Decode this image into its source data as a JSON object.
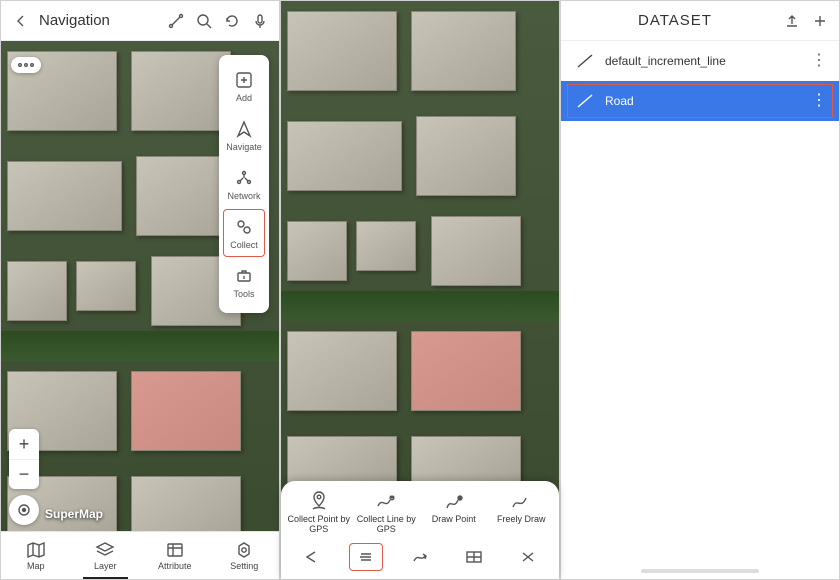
{
  "panel1": {
    "title": "Navigation",
    "toolcol": [
      {
        "label": "Add",
        "icon": "plus-square-icon"
      },
      {
        "label": "Navigate",
        "icon": "navigate-icon"
      },
      {
        "label": "Network",
        "icon": "network-icon"
      },
      {
        "label": "Collect",
        "icon": "collect-icon",
        "selected": true
      },
      {
        "label": "Tools",
        "icon": "tools-icon"
      }
    ],
    "attribution": "SuperMap",
    "bottom_nav": [
      {
        "label": "Map",
        "icon": "map-icon"
      },
      {
        "label": "Layer",
        "icon": "layer-icon",
        "active": true
      },
      {
        "label": "Attribute",
        "icon": "attribute-icon"
      },
      {
        "label": "Setting",
        "icon": "setting-icon"
      }
    ]
  },
  "panel2": {
    "actions": [
      {
        "label": "Collect Point by GPS",
        "icon": "gps-point-icon"
      },
      {
        "label": "Collect Line by GPS",
        "icon": "gps-line-icon"
      },
      {
        "label": "Draw Point",
        "icon": "draw-point-icon"
      },
      {
        "label": "Freely Draw",
        "icon": "freely-draw-icon"
      }
    ],
    "mini": [
      {
        "icon": "back-arrow-icon"
      },
      {
        "icon": "lines-icon",
        "selected": true
      },
      {
        "icon": "curve-arrow-icon"
      },
      {
        "icon": "grid-icon"
      },
      {
        "icon": "tools-cross-icon"
      }
    ]
  },
  "panel3": {
    "title": "DATASET",
    "rows": [
      {
        "label": "default_increment_line"
      },
      {
        "label": "Road",
        "selected": true
      }
    ]
  }
}
